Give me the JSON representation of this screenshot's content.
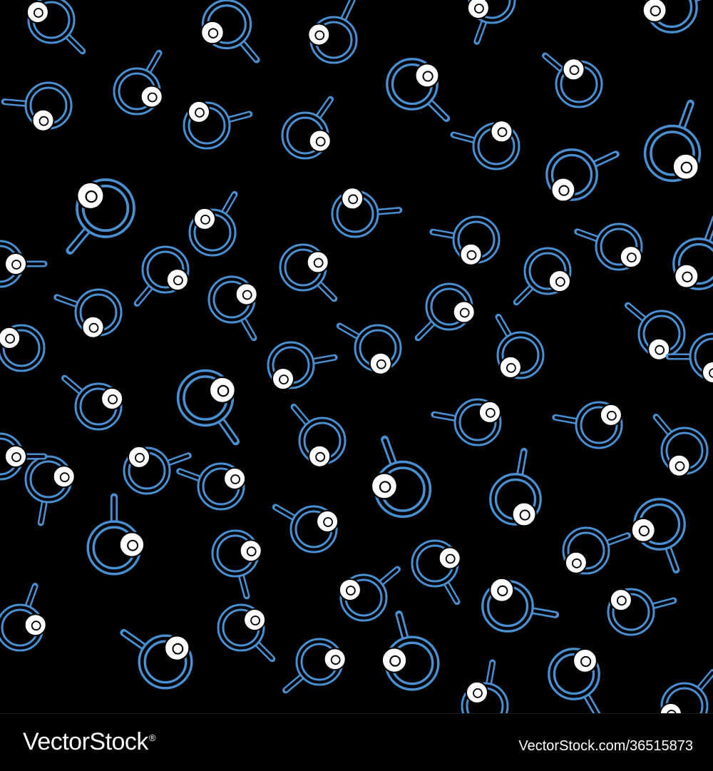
{
  "watermark": {
    "brand": "VectorStock",
    "registered_mark": "®",
    "image_id": "VectorStock.com/36515873"
  },
  "pattern": {
    "icon": "frying-pan-with-egg-icon",
    "background_color": "#000000",
    "outline_color": "#4a90d0",
    "egg_color": "#ffffff"
  }
}
